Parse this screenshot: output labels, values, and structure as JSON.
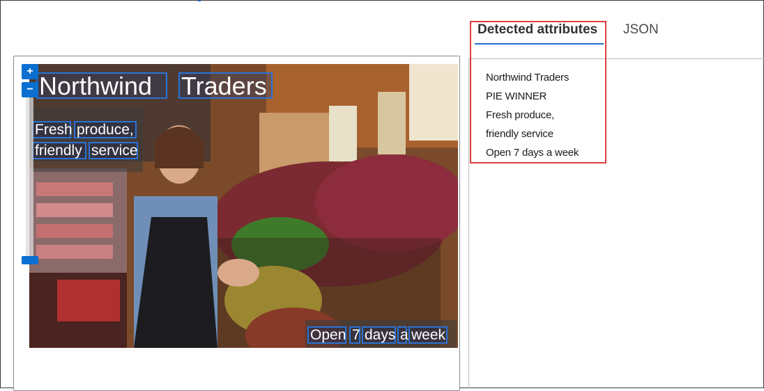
{
  "tabs": [
    {
      "label": "Detected attributes",
      "active": true
    },
    {
      "label": "JSON",
      "active": false
    }
  ],
  "attributes": [
    "Northwind Traders",
    "PIE WINNER",
    "Fresh produce,",
    "friendly service",
    "Open 7 days a week"
  ],
  "image_overlay": {
    "title_words": [
      "Northwind",
      "Traders"
    ],
    "line1_words": [
      "Fresh",
      "produce,"
    ],
    "line2_words": [
      "friendly",
      "service"
    ],
    "footer_words": [
      "Open",
      "7",
      "days",
      "a",
      "week"
    ]
  },
  "zoom": {
    "in_label": "+",
    "out_label": "−"
  },
  "colors": {
    "accent": "#0b6fd0",
    "highlight": "#e03c3c",
    "ocr_box": "#2a73d8"
  }
}
